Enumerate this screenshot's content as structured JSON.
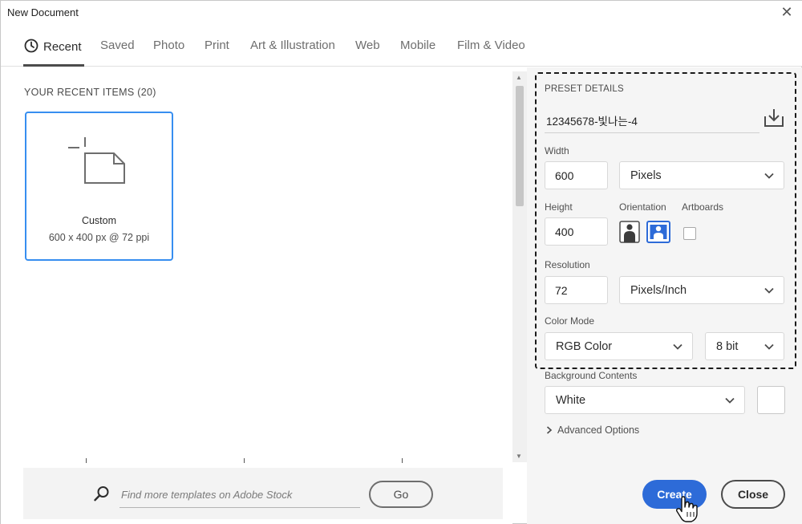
{
  "window": {
    "title": "New Document",
    "close_glyph": "✕"
  },
  "tabs": [
    {
      "label": "Recent",
      "active": true,
      "icon": "clock-icon"
    },
    {
      "label": "Saved",
      "active": false
    },
    {
      "label": "Photo",
      "active": false
    },
    {
      "label": "Print",
      "active": false
    },
    {
      "label": "Art & Illustration",
      "active": false
    },
    {
      "label": "Web",
      "active": false
    },
    {
      "label": "Mobile",
      "active": false
    },
    {
      "label": "Film & Video",
      "active": false
    }
  ],
  "recent": {
    "heading": "YOUR RECENT ITEMS  (20)",
    "items": [
      {
        "name": "Custom",
        "dims": "600 x 400 px @ 72 ppi"
      }
    ]
  },
  "stock": {
    "placeholder": "Find more templates on Adobe Stock",
    "go_label": "Go"
  },
  "preset": {
    "section_label": "PRESET DETAILS",
    "name": "12345678-빛나는-4",
    "width_label": "Width",
    "width_value": "600",
    "width_unit": "Pixels",
    "height_label": "Height",
    "height_value": "400",
    "orientation_label": "Orientation",
    "artboards_label": "Artboards",
    "artboards_checked": false,
    "resolution_label": "Resolution",
    "resolution_value": "72",
    "resolution_unit": "Pixels/Inch",
    "color_mode_label": "Color Mode",
    "color_mode": "RGB Color",
    "bit_depth": "8 bit",
    "background_label": "Background Contents",
    "background": "White",
    "background_color": "#ffffff",
    "advanced_label": "Advanced Options"
  },
  "actions": {
    "create_label": "Create",
    "close_label": "Close"
  },
  "colors": {
    "accent": "#378ef0",
    "create_button": "#2d6bd8"
  }
}
